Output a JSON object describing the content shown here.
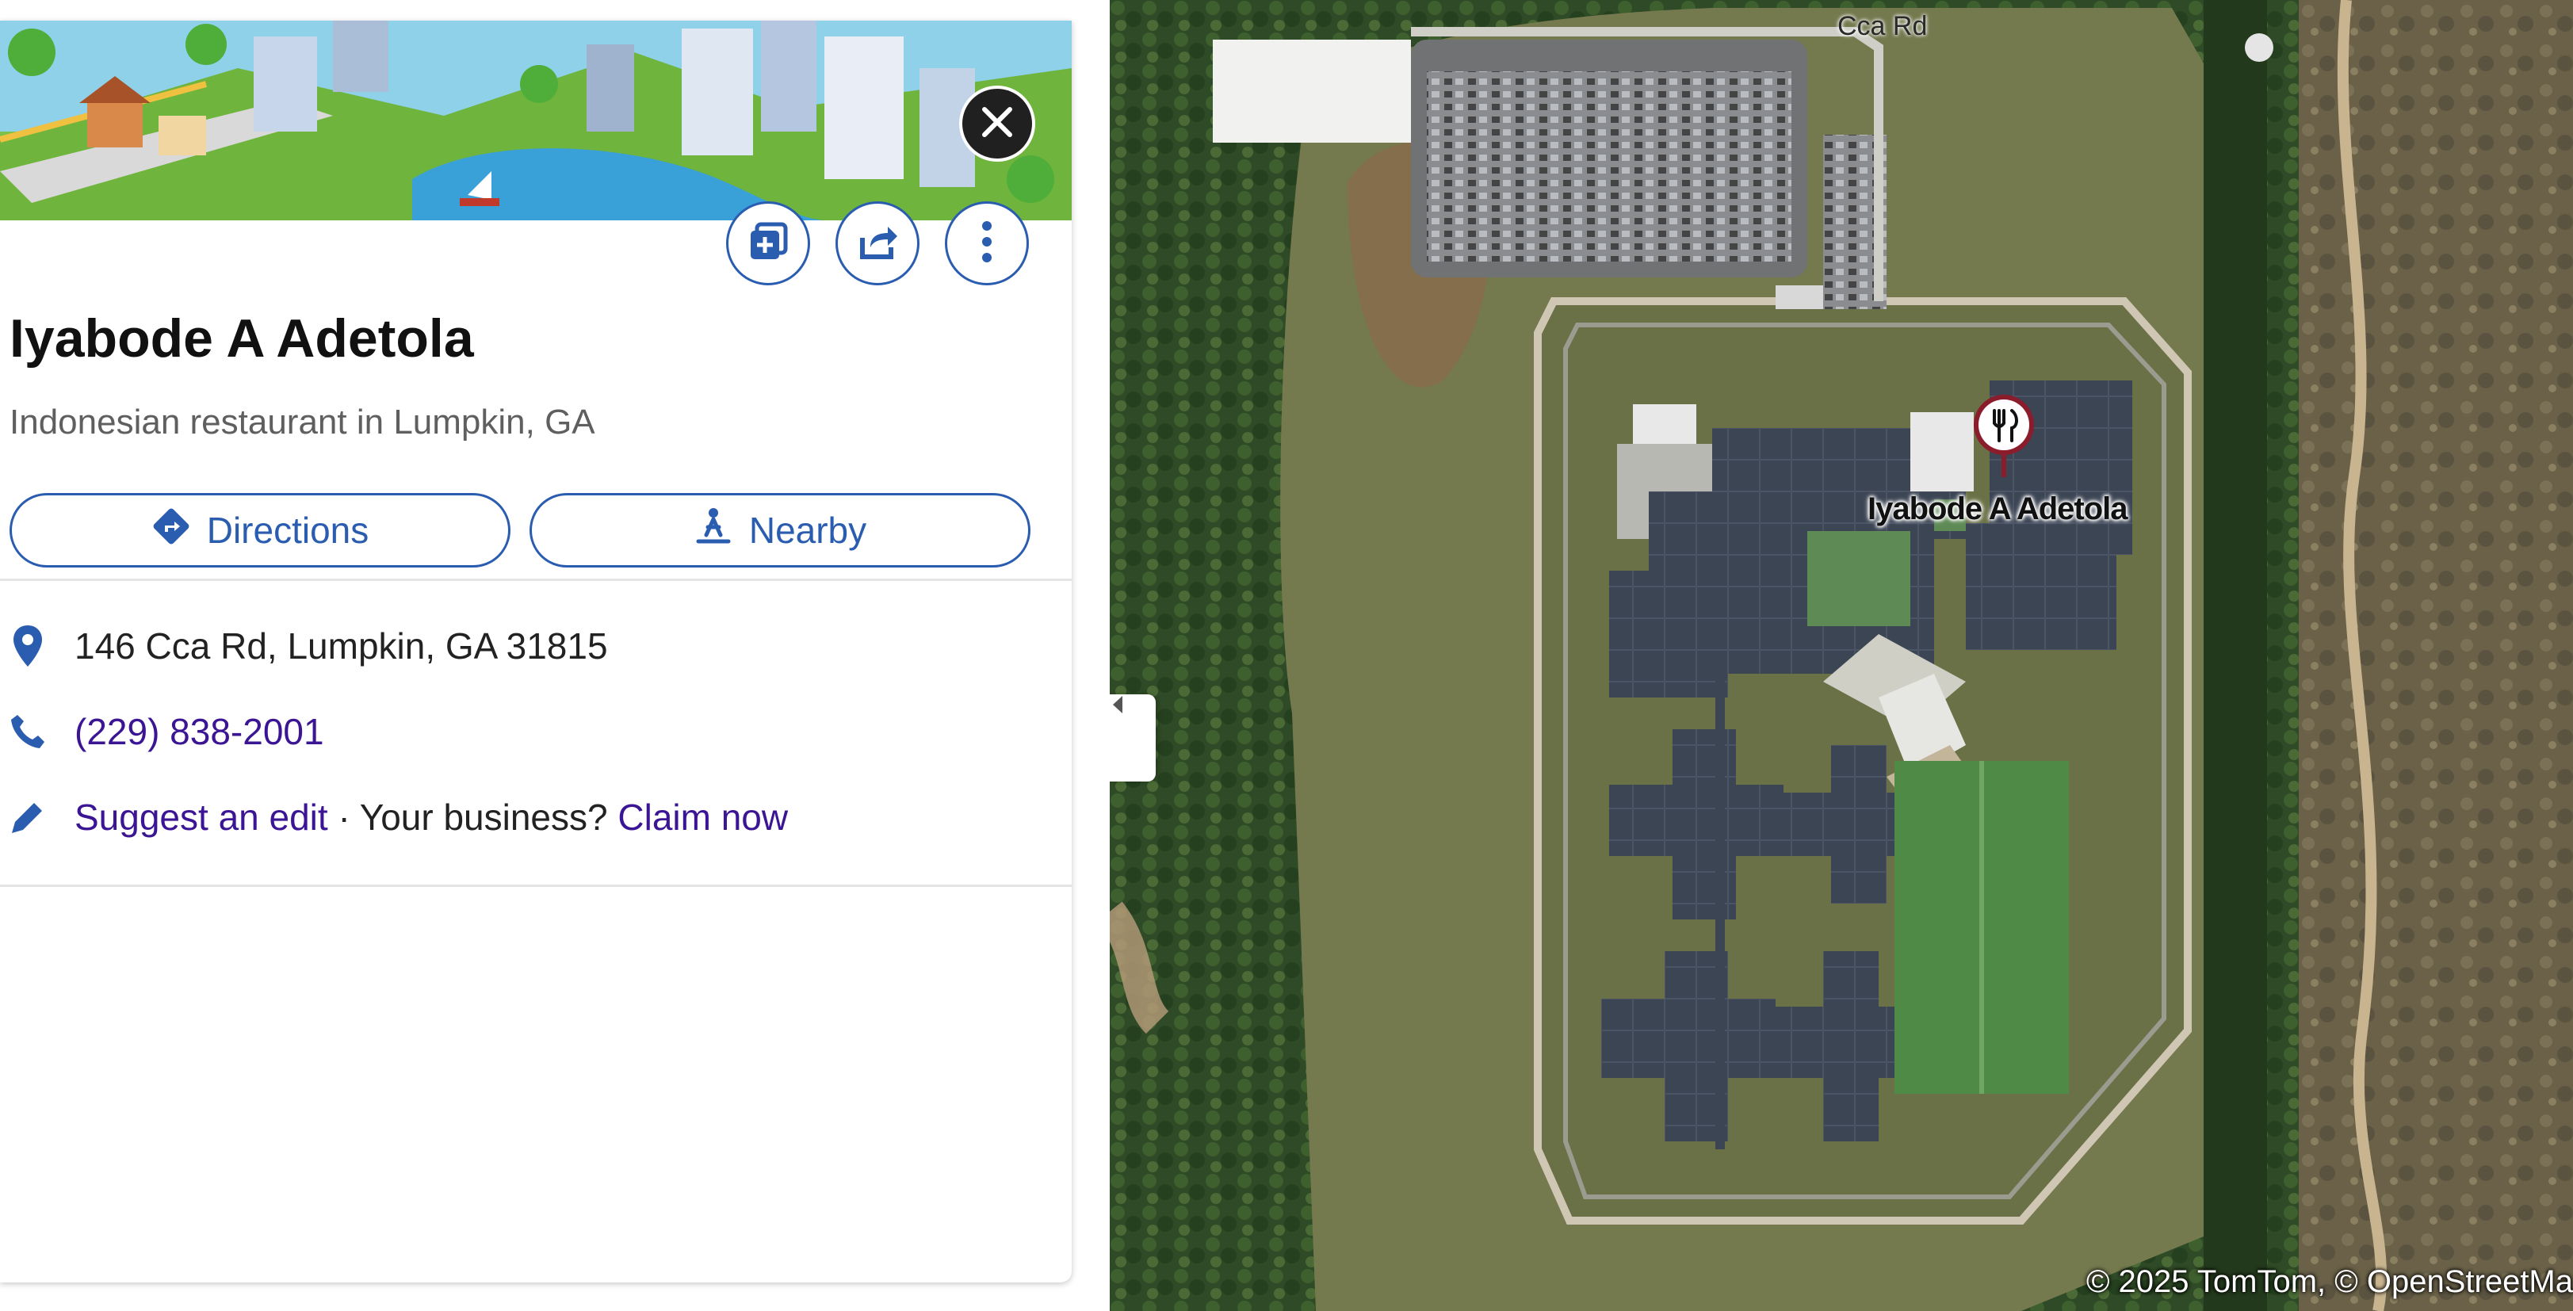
{
  "place": {
    "name": "Iyabode A Adetola",
    "category": "Indonesian restaurant in Lumpkin, GA",
    "address": "146 Cca Rd, Lumpkin, GA 31815",
    "phone": "(229) 838-2001"
  },
  "actions": {
    "directions_label": "Directions",
    "nearby_label": "Nearby"
  },
  "edit_row": {
    "suggest_label": "Suggest an edit",
    "separator": " · Your business? ",
    "claim_label": "Claim now"
  },
  "header_buttons": [
    "close-icon",
    "save-to-collection-icon",
    "share-icon",
    "more-options-icon"
  ],
  "map": {
    "road_label": "Cca Rd",
    "pin_label": "Iyabode A Adetola",
    "pin_icon": "fork-knife-icon",
    "attribution": "© 2025 TomTom,  © OpenStreetMa"
  },
  "colors": {
    "accent": "#2a5db0",
    "link": "#3b1594",
    "pin": "#8b1c2c"
  }
}
